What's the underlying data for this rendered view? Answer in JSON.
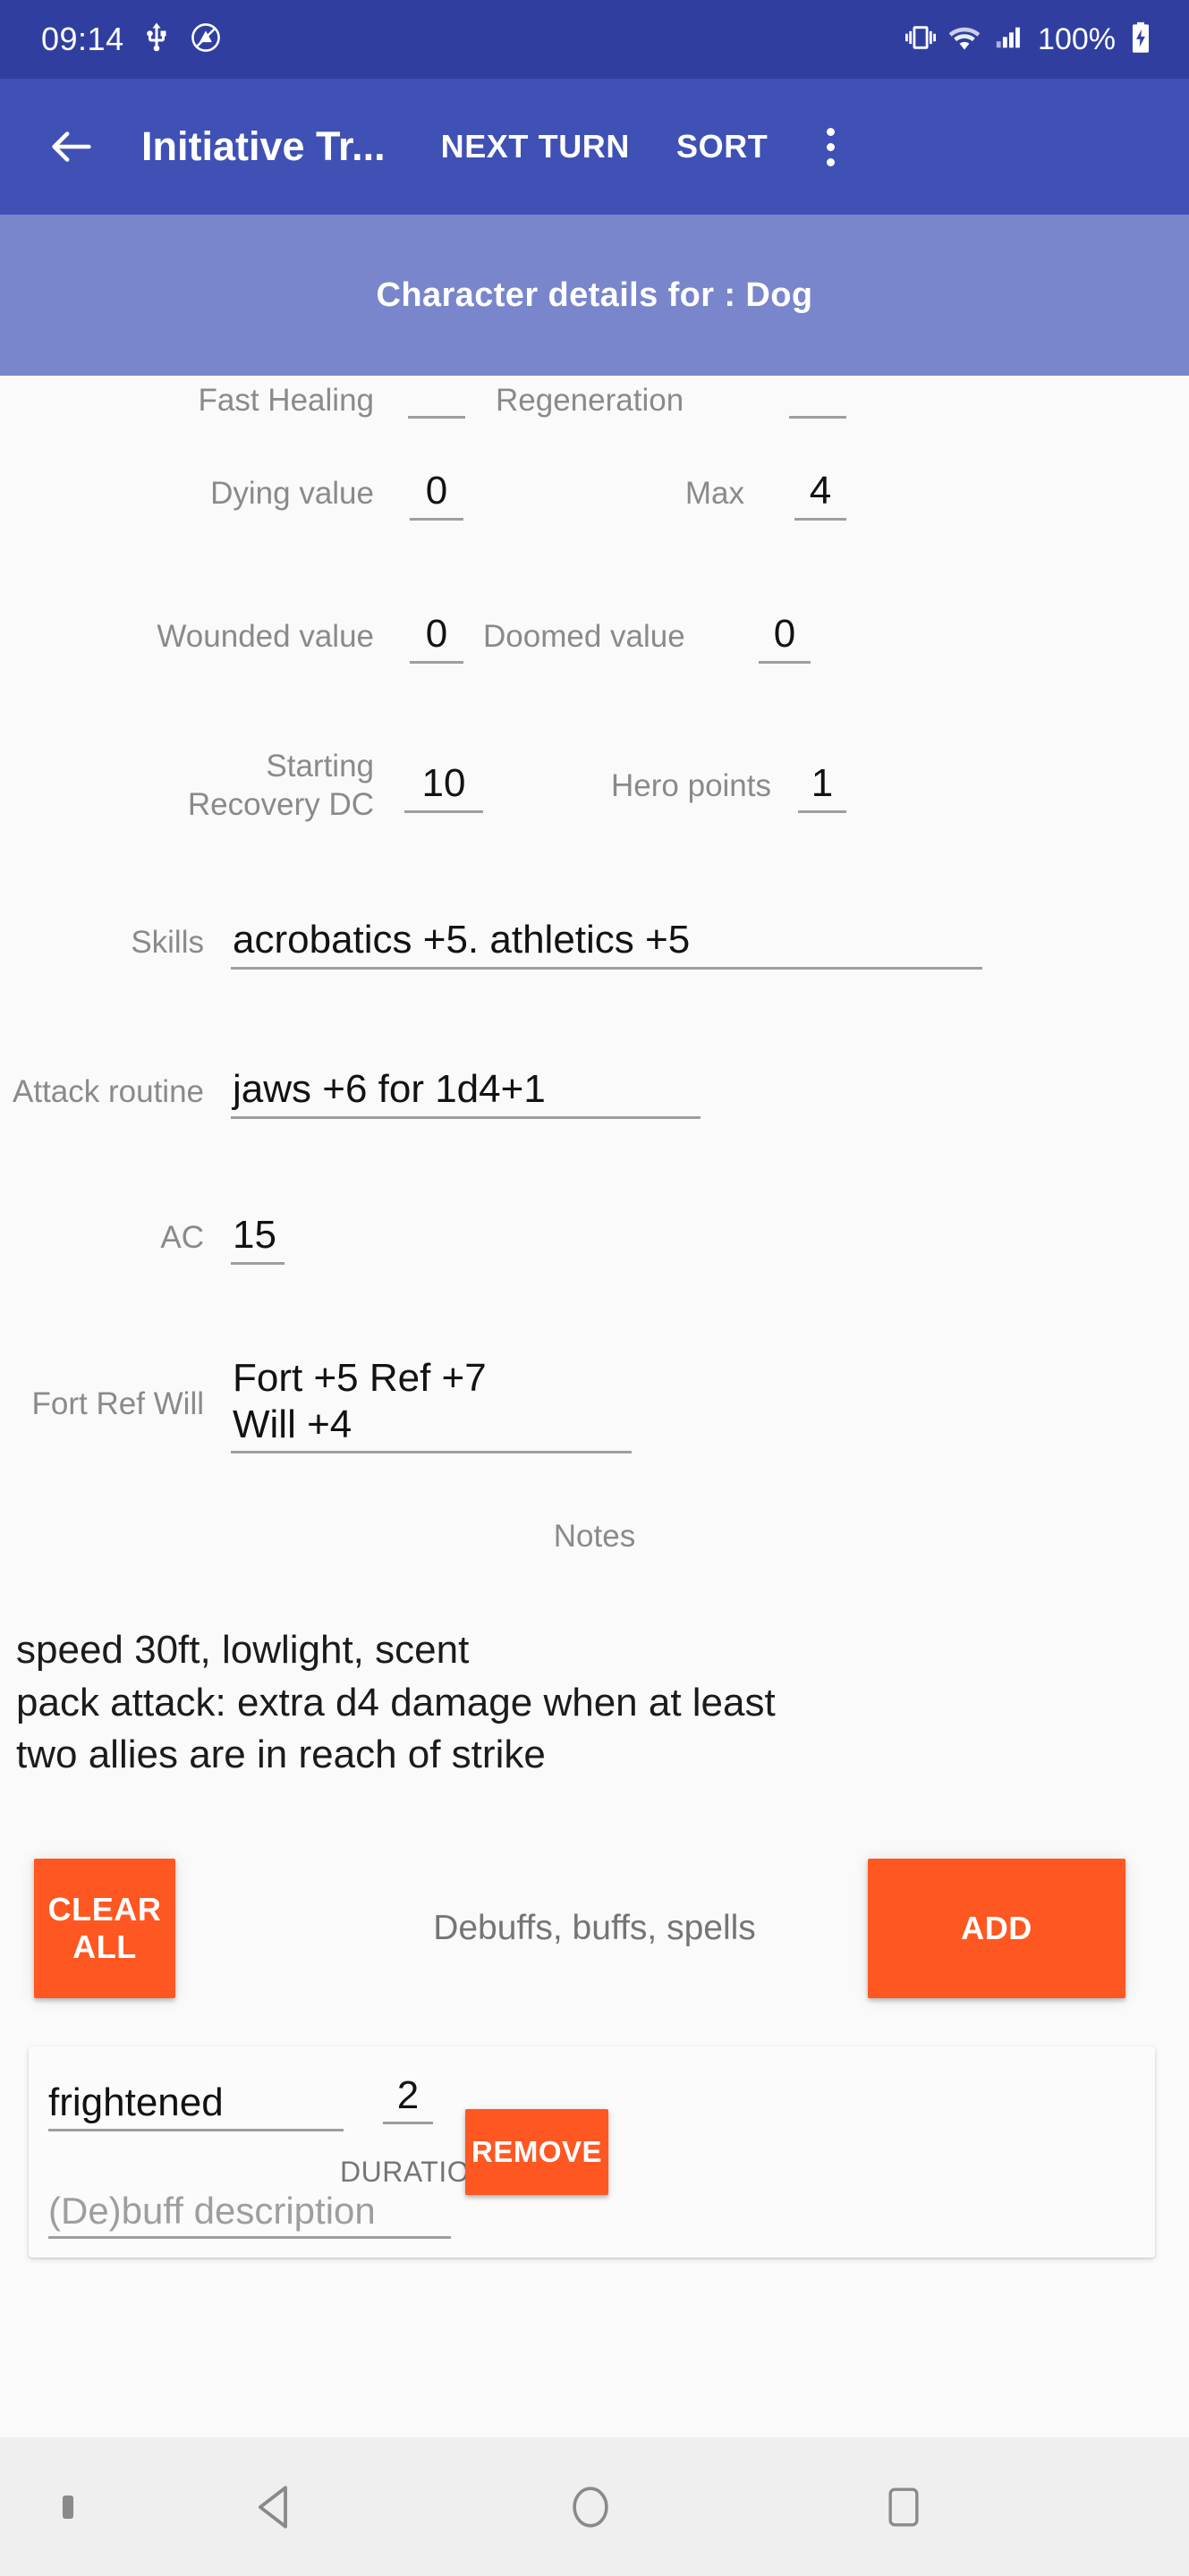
{
  "status_bar": {
    "time": "09:14",
    "battery_percent": "100%",
    "icons": [
      "usb-icon",
      "do-not-disturb-icon",
      "vibrate-icon",
      "wifi-icon",
      "cellular-signal-icon",
      "battery-charging-icon"
    ],
    "background": "#303F9F"
  },
  "app_bar": {
    "back_icon": "back-arrow-icon",
    "title": "Initiative Tr...",
    "next_turn_label": "NEXT TURN",
    "sort_label": "SORT",
    "overflow_icon": "overflow-menu-icon",
    "background": "#3F51B5"
  },
  "sub_header": {
    "text": "Character details for :  Dog",
    "background": "#7986CB"
  },
  "form": {
    "rows": [
      {
        "label_a": "Fast Healing",
        "value_a": "",
        "label_b": "Regeneration",
        "value_b": ""
      },
      {
        "label_a": "Dying value",
        "value_a": "0",
        "label_b": "Max",
        "value_b": "4"
      },
      {
        "label_a": "Wounded value",
        "value_a": "0",
        "label_b": "Doomed value",
        "value_b": "0"
      },
      {
        "label_a": "Starting\nRecovery DC",
        "value_a": "10",
        "label_b": "Hero points",
        "value_b": "1"
      }
    ],
    "skills": {
      "label": "Skills",
      "value": "acrobatics +5. athletics +5"
    },
    "attack_routine": {
      "label": "Attack routine",
      "value": "jaws +6 for 1d4+1"
    },
    "ac": {
      "label": "AC",
      "value": "15"
    },
    "fort_ref_will": {
      "label": "Fort Ref Will",
      "value": "Fort +5 Ref +7\nWill +4"
    }
  },
  "notes": {
    "label": "Notes",
    "text": "speed 30ft, lowlight, scent\npack attack: extra d4 damage when at least\ntwo allies are in reach of strike"
  },
  "buff_section": {
    "clear_all_label": "CLEAR ALL",
    "hint": "Debuffs, buffs, spells",
    "add_label": "ADD",
    "accent_color": "#FF5722"
  },
  "debuff_card": {
    "name": "frightened",
    "duration": "2",
    "duration_label": "DURATION",
    "remove_label": "REMOVE",
    "description_placeholder": "(De)buff description"
  },
  "nav_bar": {
    "back_icon": "nav-back-icon",
    "home_icon": "nav-home-icon",
    "recents_icon": "nav-recents-icon",
    "background": "#efefef"
  }
}
